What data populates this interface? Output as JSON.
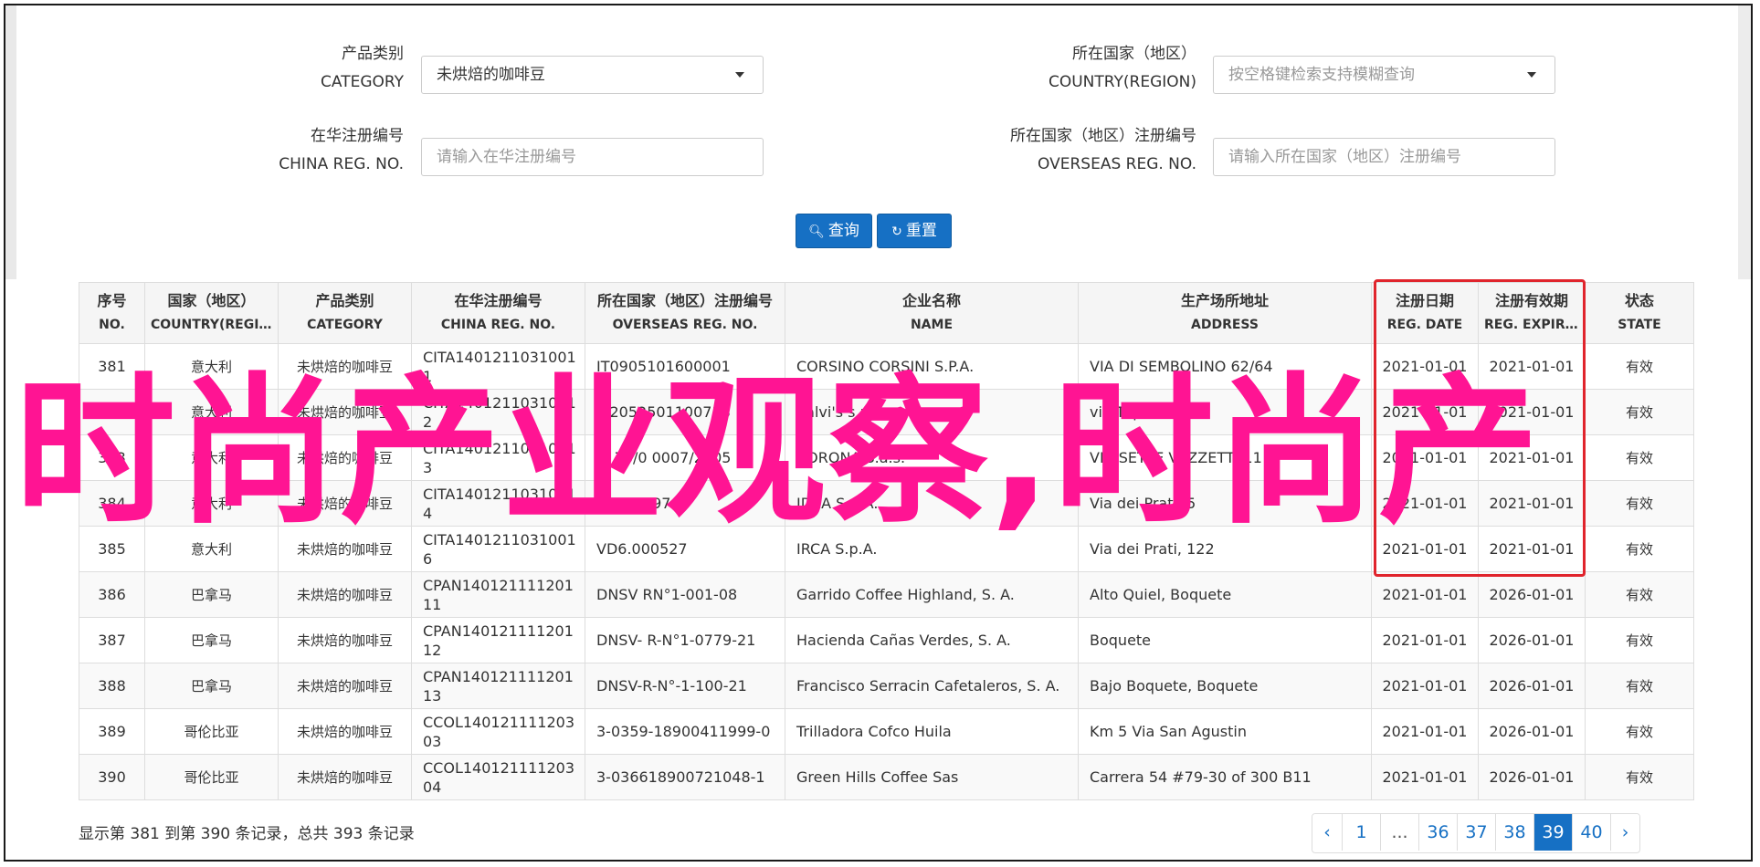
{
  "form": {
    "category_label_zh": "产品类别",
    "category_label_en": "CATEGORY",
    "category_value": "未烘焙的咖啡豆",
    "country_label_zh": "所在国家（地区）",
    "country_label_en": "COUNTRY(REGION)",
    "country_placeholder": "按空格键检索支持模糊查询",
    "china_reg_label_zh": "在华注册编号",
    "china_reg_label_en": "CHINA REG. NO.",
    "china_reg_placeholder": "请输入在华注册编号",
    "overseas_reg_label_zh": "所在国家（地区）注册编号",
    "overseas_reg_label_en": "OVERSEAS REG. NO.",
    "overseas_reg_placeholder": "请输入所在国家（地区）注册编号",
    "search_label": "查询",
    "reset_label": "重置"
  },
  "table": {
    "headers": [
      {
        "zh": "序号",
        "en": "NO."
      },
      {
        "zh": "国家（地区）",
        "en": "COUNTRY(REGION)"
      },
      {
        "zh": "产品类别",
        "en": "CATEGORY"
      },
      {
        "zh": "在华注册编号",
        "en": "CHINA REG. NO."
      },
      {
        "zh": "所在国家（地区）注册编号",
        "en": "OVERSEAS REG. NO."
      },
      {
        "zh": "企业名称",
        "en": "NAME"
      },
      {
        "zh": "生产场所地址",
        "en": "ADDRESS"
      },
      {
        "zh": "注册日期",
        "en": "REG. DATE"
      },
      {
        "zh": "注册有效期",
        "en": "REG. EXPIRE DATE"
      },
      {
        "zh": "状态",
        "en": "STATE"
      }
    ],
    "rows": [
      [
        "381",
        "意大利",
        "未烘焙的咖啡豆",
        "CITA14012110310011",
        "IT0905101600001",
        "CORSINO CORSINI S.P.A.",
        "VIA DI SEMBOLINO 62/64",
        "2021-01-01",
        "2021-01-01",
        "有效"
      ],
      [
        "382",
        "意大利",
        "未烘焙的咖啡豆",
        "CITA14012110310012",
        "IT2052501100718",
        "Salvi's s.r.l.",
        "via Tripoli",
        "2021-01-01",
        "2021-01-01",
        "有效"
      ],
      [
        "383",
        "意大利",
        "未烘焙的咖啡豆",
        "CITA14012110310013",
        "IT 76/0 0007/2005",
        "CORONA S.a.s.",
        "VIA SETTE VAZZETTI 11",
        "2021-01-01",
        "2021-01-01",
        "有效"
      ],
      [
        "384",
        "意大利",
        "未烘焙的咖啡豆",
        "CITA14012110310014",
        "159.0 697",
        "IDEA S.p.A.",
        "Via dei Prati, 5",
        "2021-01-01",
        "2021-01-01",
        "有效"
      ],
      [
        "385",
        "意大利",
        "未烘焙的咖啡豆",
        "CITA14012110310016",
        "VD6.000527",
        "IRCA S.p.A.",
        "Via dei Prati, 122",
        "2021-01-01",
        "2021-01-01",
        "有效"
      ],
      [
        "386",
        "巴拿马",
        "未烘焙的咖啡豆",
        "CPAN14012111120111",
        "DNSV RN°1-001-08",
        "Garrido Coffee Highland, S. A.",
        "Alto Quiel, Boquete",
        "2021-01-01",
        "2026-01-01",
        "有效"
      ],
      [
        "387",
        "巴拿马",
        "未烘焙的咖啡豆",
        "CPAN14012111120112",
        "DNSV- R-N°1-0779-21",
        "Hacienda Cañas Verdes, S. A.",
        "Boquete",
        "2021-01-01",
        "2026-01-01",
        "有效"
      ],
      [
        "388",
        "巴拿马",
        "未烘焙的咖啡豆",
        "CPAN14012111120113",
        "DNSV-R-N°-1-100-21",
        "Francisco Serracin Cafetaleros, S. A.",
        "Bajo Boquete, Boquete",
        "2021-01-01",
        "2026-01-01",
        "有效"
      ],
      [
        "389",
        "哥伦比亚",
        "未烘焙的咖啡豆",
        "CCOL14012111120303",
        "3-0359-18900411999-0",
        "Trilladora Cofco Huila",
        "Km 5 Via San Agustin",
        "2021-01-01",
        "2026-01-01",
        "有效"
      ],
      [
        "390",
        "哥伦比亚",
        "未烘焙的咖啡豆",
        "CCOL14012111120304",
        "3-036618900721048-1",
        "Green Hills Coffee Sas",
        "Carrera 54 #79-30 of 300 B11",
        "2021-01-01",
        "2026-01-01",
        "有效"
      ]
    ]
  },
  "overlay_text": "时尚产业观察,时尚产",
  "summary": "显示第 381 到第 390 条记录，总共 393 条记录",
  "pagination": {
    "items": [
      "‹",
      "1",
      "...",
      "36",
      "37",
      "38",
      "39",
      "40",
      "›"
    ],
    "active": "39"
  }
}
